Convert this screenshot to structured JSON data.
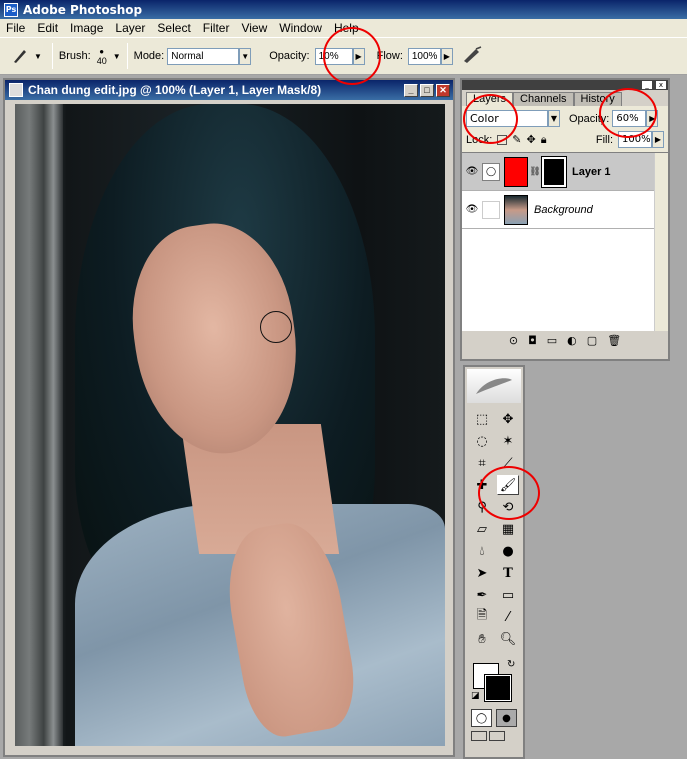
{
  "app": {
    "title": "Adobe Photoshop"
  },
  "menu": [
    "File",
    "Edit",
    "Image",
    "Layer",
    "Select",
    "Filter",
    "View",
    "Window",
    "Help"
  ],
  "options": {
    "brush_label": "Brush:",
    "brush_size": "40",
    "mode_label": "Mode:",
    "mode_value": "Normal",
    "opacity_label": "Opacity:",
    "opacity_value": "10%",
    "flow_label": "Flow:",
    "flow_value": "100%"
  },
  "document": {
    "title": "Chan dung edit.jpg @ 100% (Layer 1, Layer Mask/8)"
  },
  "layers_panel": {
    "tabs": [
      "Layers",
      "Channels",
      "History"
    ],
    "blend_mode": "Color",
    "opacity_label": "Opacity:",
    "opacity_value": "60%",
    "lock_label": "Lock:",
    "fill_label": "Fill:",
    "fill_value": "100%",
    "layers": [
      {
        "name": "Layer 1",
        "selected": true
      },
      {
        "name": "Background",
        "selected": false
      }
    ]
  },
  "toolbox": {
    "tools": [
      "marquee-icon",
      "move-icon",
      "lasso-icon",
      "magic-wand-icon",
      "crop-icon",
      "slice-icon",
      "healing-brush-icon",
      "brush-icon",
      "stamp-icon",
      "history-brush-icon",
      "eraser-icon",
      "gradient-icon",
      "blur-icon",
      "dodge-icon",
      "path-select-icon",
      "type-icon",
      "pen-icon",
      "shape-icon",
      "notes-icon",
      "eyedropper-icon",
      "hand-icon",
      "zoom-icon"
    ],
    "type_glyph": "T"
  },
  "colors": {
    "highlight_circle": "#e00000",
    "layer1_thumb": "#ff0000"
  }
}
